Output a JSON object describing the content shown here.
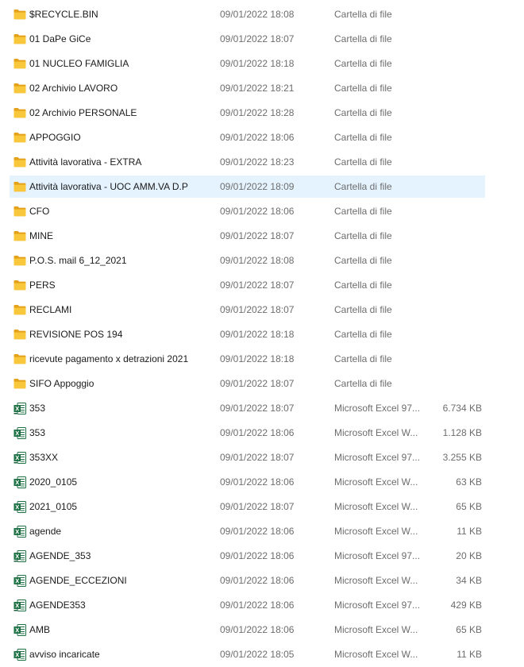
{
  "colors": {
    "folder_yellow": "#f8c73c",
    "folder_dark": "#e3a21a",
    "excel_green": "#1e7145",
    "selection_bg": "#e5f3ff",
    "secondary_text": "#6d6d6d"
  },
  "files": [
    {
      "name": "$RECYCLE.BIN",
      "date": "09/01/2022 18:08",
      "type": "Cartella di file",
      "size": "",
      "icon": "folder-icon",
      "selected": false
    },
    {
      "name": "01 DaPe  GiCe",
      "date": "09/01/2022 18:07",
      "type": "Cartella di file",
      "size": "",
      "icon": "folder-icon",
      "selected": false
    },
    {
      "name": "01 NUCLEO FAMIGLIA",
      "date": "09/01/2022 18:18",
      "type": "Cartella di file",
      "size": "",
      "icon": "folder-icon",
      "selected": false
    },
    {
      "name": "02 Archivio LAVORO",
      "date": "09/01/2022 18:21",
      "type": "Cartella di file",
      "size": "",
      "icon": "folder-icon",
      "selected": false
    },
    {
      "name": "02 Archivio PERSONALE",
      "date": "09/01/2022 18:28",
      "type": "Cartella di file",
      "size": "",
      "icon": "folder-icon",
      "selected": false
    },
    {
      "name": "APPOGGIO",
      "date": "09/01/2022 18:06",
      "type": "Cartella di file",
      "size": "",
      "icon": "folder-icon",
      "selected": false
    },
    {
      "name": "Attività lavorativa - EXTRA",
      "date": "09/01/2022 18:23",
      "type": "Cartella di file",
      "size": "",
      "icon": "folder-icon",
      "selected": false
    },
    {
      "name": "Attività lavorativa - UOC AMM.VA D.P",
      "date": "09/01/2022 18:09",
      "type": "Cartella di file",
      "size": "",
      "icon": "folder-icon",
      "selected": true
    },
    {
      "name": "CFO",
      "date": "09/01/2022 18:06",
      "type": "Cartella di file",
      "size": "",
      "icon": "folder-icon",
      "selected": false
    },
    {
      "name": "MINE",
      "date": "09/01/2022 18:07",
      "type": "Cartella di file",
      "size": "",
      "icon": "folder-icon",
      "selected": false
    },
    {
      "name": "P.O.S.  mail 6_12_2021",
      "date": "09/01/2022 18:08",
      "type": "Cartella di file",
      "size": "",
      "icon": "folder-icon",
      "selected": false
    },
    {
      "name": "PERS",
      "date": "09/01/2022 18:07",
      "type": "Cartella di file",
      "size": "",
      "icon": "folder-icon",
      "selected": false
    },
    {
      "name": "RECLAMI",
      "date": "09/01/2022 18:07",
      "type": "Cartella di file",
      "size": "",
      "icon": "folder-icon",
      "selected": false
    },
    {
      "name": "REVISIONE POS 194",
      "date": "09/01/2022 18:18",
      "type": "Cartella di file",
      "size": "",
      "icon": "folder-icon",
      "selected": false
    },
    {
      "name": "ricevute pagamento x detrazioni 2021",
      "date": "09/01/2022 18:18",
      "type": "Cartella di file",
      "size": "",
      "icon": "folder-icon",
      "selected": false
    },
    {
      "name": "SIFO Appoggio",
      "date": "09/01/2022 18:07",
      "type": "Cartella di file",
      "size": "",
      "icon": "folder-icon",
      "selected": false
    },
    {
      "name": "353",
      "date": "09/01/2022 18:07",
      "type": "Microsoft Excel 97...",
      "size": "6.734 KB",
      "icon": "excel-97-icon",
      "selected": false
    },
    {
      "name": "353",
      "date": "09/01/2022 18:06",
      "type": "Microsoft Excel W...",
      "size": "1.128 KB",
      "icon": "excel-icon",
      "selected": false
    },
    {
      "name": "353XX",
      "date": "09/01/2022 18:07",
      "type": "Microsoft Excel 97...",
      "size": "3.255 KB",
      "icon": "excel-97-icon",
      "selected": false
    },
    {
      "name": "2020_0105",
      "date": "09/01/2022 18:06",
      "type": "Microsoft Excel W...",
      "size": "63 KB",
      "icon": "excel-icon",
      "selected": false
    },
    {
      "name": "2021_0105",
      "date": "09/01/2022 18:07",
      "type": "Microsoft Excel W...",
      "size": "65 KB",
      "icon": "excel-icon",
      "selected": false
    },
    {
      "name": "agende",
      "date": "09/01/2022 18:06",
      "type": "Microsoft Excel W...",
      "size": "11 KB",
      "icon": "excel-icon",
      "selected": false
    },
    {
      "name": "AGENDE_353",
      "date": "09/01/2022 18:06",
      "type": "Microsoft Excel 97...",
      "size": "20 KB",
      "icon": "excel-97-icon",
      "selected": false
    },
    {
      "name": "AGENDE_ECCEZIONI",
      "date": "09/01/2022 18:06",
      "type": "Microsoft Excel W...",
      "size": "34 KB",
      "icon": "excel-icon",
      "selected": false
    },
    {
      "name": "AGENDE353",
      "date": "09/01/2022 18:06",
      "type": "Microsoft Excel 97...",
      "size": "429 KB",
      "icon": "excel-97-icon",
      "selected": false
    },
    {
      "name": "AMB",
      "date": "09/01/2022 18:06",
      "type": "Microsoft Excel W...",
      "size": "65 KB",
      "icon": "excel-icon",
      "selected": false
    },
    {
      "name": "avviso incaricate",
      "date": "09/01/2022 18:05",
      "type": "Microsoft Excel W...",
      "size": "11 KB",
      "icon": "excel-icon",
      "selected": false
    }
  ]
}
